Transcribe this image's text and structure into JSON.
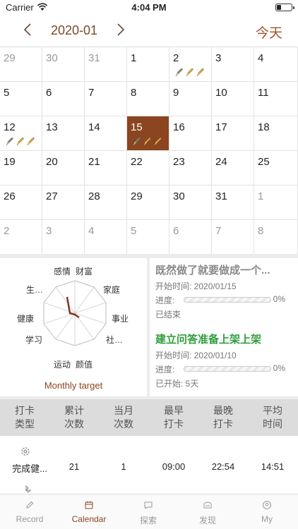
{
  "status": {
    "carrier": "Carrier",
    "time": "4:04 PM"
  },
  "nav": {
    "month": "2020-01",
    "today": "今天"
  },
  "calendar": {
    "weeks": [
      [
        {
          "d": "29",
          "o": 1
        },
        {
          "d": "30",
          "o": 1
        },
        {
          "d": "31",
          "o": 1
        },
        {
          "d": "1"
        },
        {
          "d": "2",
          "m": 3
        },
        {
          "d": "3"
        },
        {
          "d": "4"
        }
      ],
      [
        {
          "d": "5"
        },
        {
          "d": "6"
        },
        {
          "d": "7"
        },
        {
          "d": "8"
        },
        {
          "d": "9"
        },
        {
          "d": "10"
        },
        {
          "d": "11"
        }
      ],
      [
        {
          "d": "12",
          "m": 3
        },
        {
          "d": "13"
        },
        {
          "d": "14"
        },
        {
          "d": "15",
          "m": 3,
          "s": 1
        },
        {
          "d": "16"
        },
        {
          "d": "17"
        },
        {
          "d": "18"
        }
      ],
      [
        {
          "d": "19"
        },
        {
          "d": "20"
        },
        {
          "d": "21"
        },
        {
          "d": "22"
        },
        {
          "d": "23"
        },
        {
          "d": "24"
        },
        {
          "d": "25"
        }
      ],
      [
        {
          "d": "26"
        },
        {
          "d": "27"
        },
        {
          "d": "28"
        },
        {
          "d": "29"
        },
        {
          "d": "30"
        },
        {
          "d": "31"
        },
        {
          "d": "1",
          "o": 1
        }
      ],
      [
        {
          "d": "2",
          "o": 1
        },
        {
          "d": "3",
          "o": 1
        },
        {
          "d": "4",
          "o": 1
        },
        {
          "d": "5",
          "o": 1
        },
        {
          "d": "6",
          "o": 1
        },
        {
          "d": "7",
          "o": 1
        },
        {
          "d": "8",
          "o": 1
        }
      ]
    ]
  },
  "radar": {
    "labels": {
      "emotion": "感情",
      "wealth": "财富",
      "family": "家庭",
      "career": "事业",
      "social": "社…",
      "looks": "颜值",
      "sport": "运动",
      "study": "学习",
      "health": "健康",
      "life": "生…"
    },
    "monthly_target": "Monthly target"
  },
  "goals": [
    {
      "title": "既然做了就要做成一个...",
      "title_color": "#8a8a8a",
      "start": "开始时间: 2020/01/15",
      "progress_label": "进度:",
      "progress": 0,
      "progress_text": "0%",
      "status": "已结束"
    },
    {
      "title": "建立问答准备上架上架",
      "title_color": "#2e9e3a",
      "start": "开始时间: 2020/01/10",
      "progress_label": "进度:",
      "progress": 0,
      "progress_text": "0%",
      "status": "已开始: 5天"
    }
  ],
  "stats": {
    "headers": [
      [
        "打卡",
        "类型"
      ],
      [
        "累计",
        "次数"
      ],
      [
        "当月",
        "次数"
      ],
      [
        "最早",
        "打卡"
      ],
      [
        "最晚",
        "打卡"
      ],
      [
        "平均",
        "时间"
      ]
    ],
    "row": [
      "完成健...",
      "21",
      "1",
      "09:00",
      "22:54",
      "14:51"
    ]
  },
  "tabs": [
    {
      "label": "Record",
      "icon": "pencil-icon"
    },
    {
      "label": "Calendar",
      "icon": "calendar-icon",
      "active": true
    },
    {
      "label": "探索",
      "icon": "chat-icon"
    },
    {
      "label": "发现",
      "icon": "discover-icon"
    },
    {
      "label": "My",
      "icon": "user-icon"
    }
  ],
  "colors": {
    "accent": "#8b4520",
    "goal_active": "#2e9e3a"
  }
}
